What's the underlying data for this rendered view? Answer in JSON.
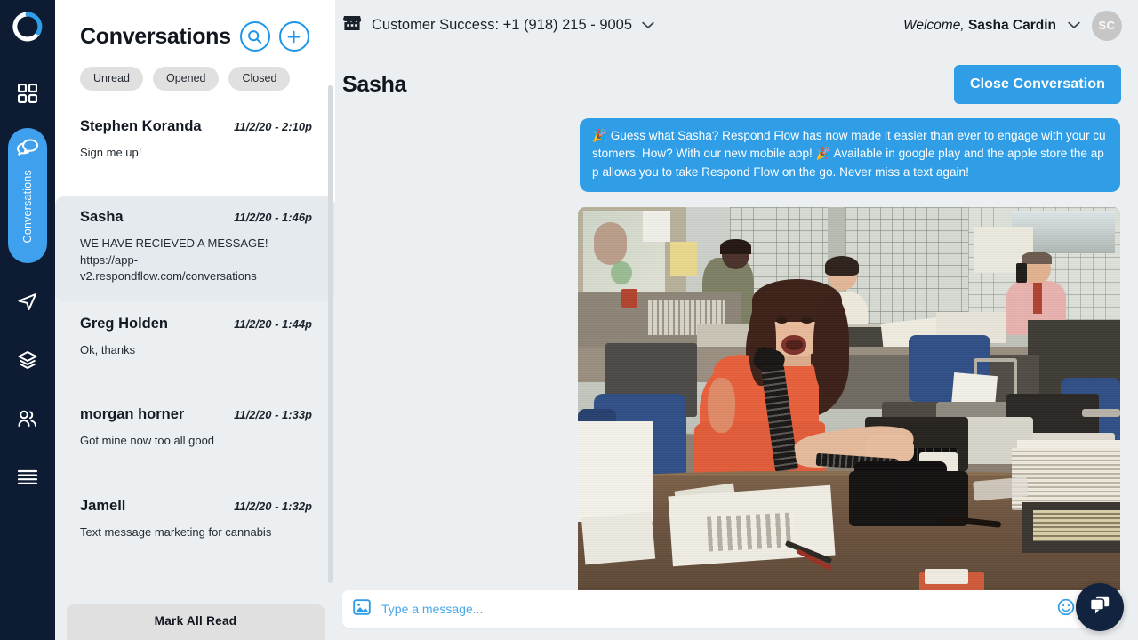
{
  "brand": {
    "accent": "#2f9ee6",
    "rail_bg": "#0d1b33",
    "page_bg": "#eceff1"
  },
  "rail": {
    "logo_name": "respond-flow-logo",
    "items": [
      {
        "name": "dashboard",
        "icon": "grid-icon",
        "label": ""
      },
      {
        "name": "conversations",
        "icon": "conversations-icon",
        "label": "Conversations",
        "active": true
      },
      {
        "name": "campaigns",
        "icon": "send-icon",
        "label": ""
      },
      {
        "name": "templates",
        "icon": "layers-icon",
        "label": ""
      },
      {
        "name": "contacts",
        "icon": "people-icon",
        "label": ""
      },
      {
        "name": "more",
        "icon": "menu-icon",
        "label": ""
      }
    ]
  },
  "list": {
    "title": "Conversations",
    "search_icon": "search-icon",
    "add_icon": "plus-icon",
    "filters": [
      "Unread",
      "Opened",
      "Closed"
    ],
    "mark_all_read": "Mark All Read",
    "items": [
      {
        "name": "Stephen Koranda",
        "time": "11/2/20 - 2:10p",
        "snippet": "Sign me up!",
        "selected": false
      },
      {
        "name": "Sasha",
        "time": "11/2/20 - 1:46p",
        "snippet": "WE HAVE RECIEVED A MESSAGE! https://app-v2.respondflow.com/conversations",
        "selected": true
      },
      {
        "name": "Greg Holden",
        "time": "11/2/20 - 1:44p",
        "snippet": "Ok, thanks",
        "selected": false
      },
      {
        "name": "morgan horner",
        "time": "11/2/20 - 1:33p",
        "snippet": "Got mine now too all good",
        "selected": false
      },
      {
        "name": "Jamell",
        "time": "11/2/20 - 1:32p",
        "snippet": "Text message marketing for cannabis",
        "selected": false
      }
    ]
  },
  "topbar": {
    "store_icon": "storefront-icon",
    "account": "Customer Success: +1 (918) 215 - 9005",
    "account_chevron": "chevron-down-icon",
    "welcome_prefix": "Welcome,",
    "welcome_name": "Sasha Cardin",
    "user_chevron": "chevron-down-icon",
    "avatar_initials": "SC"
  },
  "conversation": {
    "title": "Sasha",
    "close_button": "Close Conversation",
    "messages": [
      {
        "type": "text",
        "direction": "outgoing",
        "text": "🎉 Guess what Sasha? Respond Flow has now made it easier than ever to engage with your customers. How? With our new mobile app! 🎉 Available in google play and the apple store the app allows you to take Respond Flow on the go. Never miss a text again!"
      },
      {
        "type": "image",
        "direction": "outgoing",
        "alt": "Vintage 1970s newsroom office, woman in orange dress on telephone at typewriter looking shocked"
      }
    ]
  },
  "composer": {
    "image_icon": "image-attach-icon",
    "placeholder": "Type a message...",
    "value": "",
    "emoji_icon": "emoji-smiley-icon",
    "send_icon": "send-icon"
  },
  "chat_widget": {
    "icon": "chat-bubbles-icon"
  }
}
